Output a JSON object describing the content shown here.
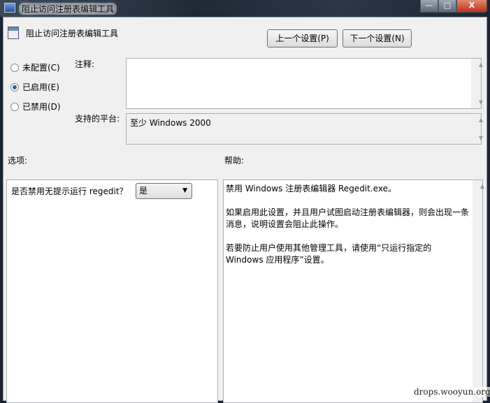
{
  "window": {
    "title": "阻止访问注册表编辑工具",
    "minimize": "—",
    "maximize": "□",
    "close": "X"
  },
  "header": {
    "title": "阻止访问注册表编辑工具",
    "prev_button": "上一个设置(P)",
    "next_button": "下一个设置(N)"
  },
  "state": {
    "options": [
      {
        "label": "未配置(C)",
        "selected": false
      },
      {
        "label": "已启用(E)",
        "selected": true
      },
      {
        "label": "已禁用(D)",
        "selected": false
      }
    ]
  },
  "comment": {
    "label": "注释:",
    "value": ""
  },
  "platform": {
    "label": "支持的平台:",
    "value": "至少 Windows 2000"
  },
  "options_panel": {
    "label": "选项:",
    "question": "是否禁用无提示运行 regedit？",
    "select_value": "是"
  },
  "help_panel": {
    "label": "帮助:",
    "paragraphs": [
      "禁用 Windows 注册表编辑器 Regedit.exe。",
      "如果启用此设置，并且用户试图启动注册表编辑器，则会出现一条消息，说明设置会阻止此操作。",
      "若要防止用户使用其他管理工具，请使用“只运行指定的 Windows 应用程序”设置。"
    ]
  },
  "watermark": "drops.wooyun.org"
}
